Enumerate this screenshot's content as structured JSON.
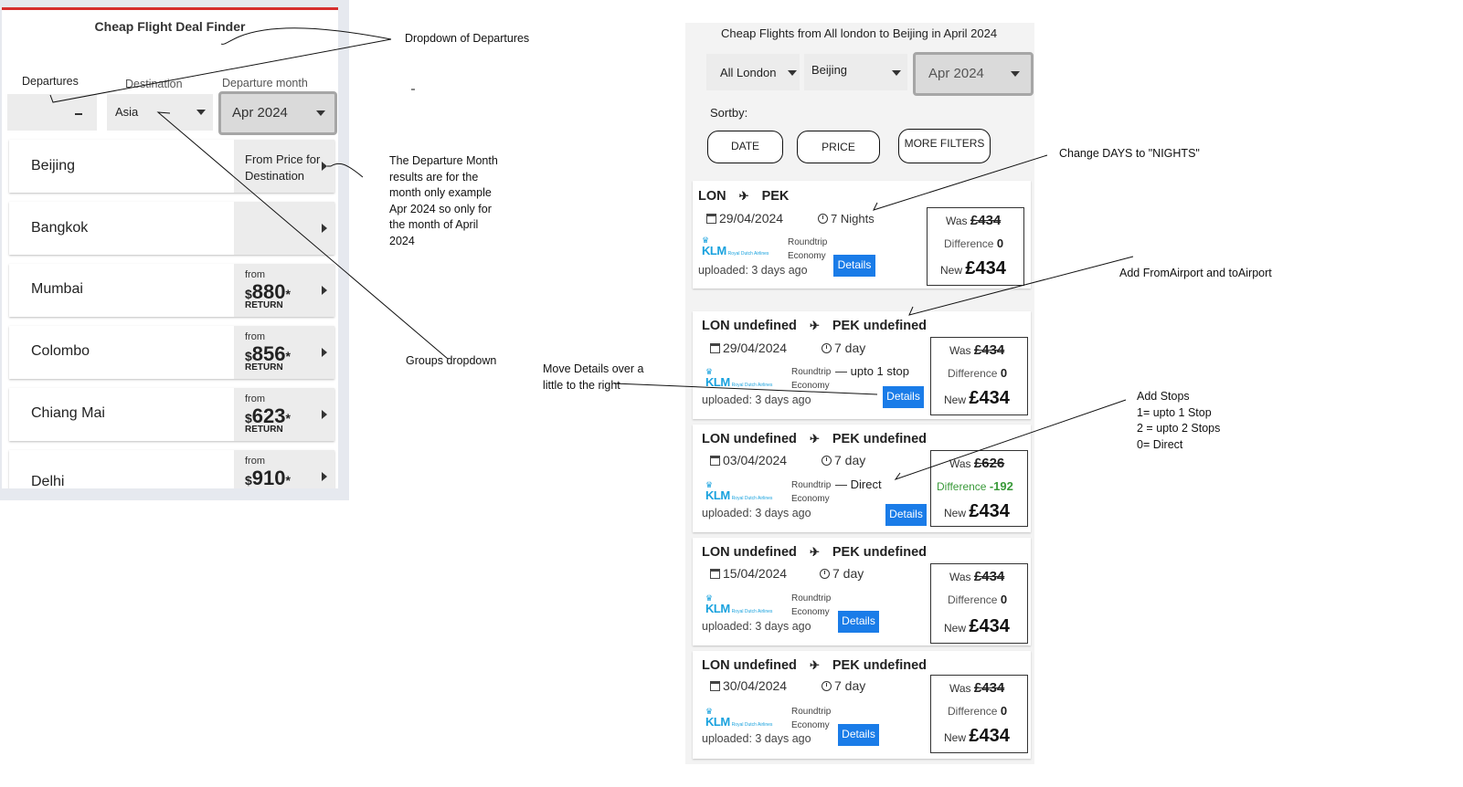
{
  "left": {
    "title": "Cheap Flight Deal Finder",
    "departures_label": "Departures",
    "destination_label": "Destination",
    "destination_value": "Asia",
    "month_label": "Departure month",
    "month_value": "Apr 2024",
    "destinations": [
      {
        "name": "Beijing",
        "price_text": "From Price for Destination"
      },
      {
        "name": "Bangkok"
      },
      {
        "name": "Mumbai",
        "from": "from",
        "currency": "$",
        "price": "880",
        "star": "*",
        "return": "RETURN"
      },
      {
        "name": "Colombo",
        "from": "from",
        "currency": "$",
        "price": "856",
        "star": "*",
        "return": "RETURN"
      },
      {
        "name": "Chiang Mai",
        "from": "from",
        "currency": "$",
        "price": "623",
        "star": "*",
        "return": "RETURN"
      },
      {
        "name": "Delhi",
        "from": "from",
        "currency": "$",
        "price": "910",
        "star": "*"
      }
    ]
  },
  "right": {
    "title": "Cheap Flights from All london to Beijing in April 2024",
    "origin_value": "All London",
    "destination_value": "Beijing",
    "month_value": "Apr 2024",
    "sortby_label": "Sortby:",
    "sort_buttons": [
      "DATE",
      "PRICE",
      "MORE FILTERS"
    ],
    "airline_logo": "KLM",
    "airline_sub": "Royal Dutch Airlines",
    "cards": [
      {
        "from": "LON",
        "to": "PEK",
        "date": "29/04/2024",
        "duration": "7 Nights",
        "trip": "Roundtrip",
        "cabin": "Economy",
        "stops": "",
        "uploaded": "uploaded: 3 days ago",
        "was_label": "Was",
        "was": "£434",
        "diff_label": "Difference",
        "diff": "0",
        "new_label": "New",
        "new": "£434",
        "details": "Details"
      },
      {
        "from": "LON undefined",
        "to": "PEK undefined",
        "date": "29/04/2024",
        "duration": "7 day",
        "trip": "Roundtrip",
        "cabin": "Economy",
        "stops": "upto 1 stop",
        "uploaded": "uploaded: 3 days ago",
        "was_label": "Was",
        "was": "£434",
        "diff_label": "Difference",
        "diff": "0",
        "new_label": "New",
        "new": "£434",
        "details": "Details"
      },
      {
        "from": "LON undefined",
        "to": "PEK undefined",
        "date": "03/04/2024",
        "duration": "7 day",
        "trip": "Roundtrip",
        "cabin": "Economy",
        "stops": "Direct",
        "uploaded": "uploaded: 3 days ago",
        "was_label": "Was",
        "was": "£626",
        "diff_label": "Difference",
        "diff": "-192",
        "new_label": "New",
        "new": "£434",
        "details": "Details"
      },
      {
        "from": "LON undefined",
        "to": "PEK undefined",
        "date": "15/04/2024",
        "duration": "7 day",
        "trip": "Roundtrip",
        "cabin": "Economy",
        "stops": "",
        "uploaded": "uploaded: 3 days ago",
        "was_label": "Was",
        "was": "£434",
        "diff_label": "Difference",
        "diff": "0",
        "new_label": "New",
        "new": "£434",
        "details": "Details"
      },
      {
        "from": "LON undefined",
        "to": "PEK undefined",
        "date": "30/04/2024",
        "duration": "7 day",
        "trip": "Roundtrip",
        "cabin": "Economy",
        "stops": "",
        "uploaded": "uploaded: 3 days ago",
        "was_label": "Was",
        "was": "£434",
        "diff_label": "Difference",
        "diff": "0",
        "new_label": "New",
        "new": "£434",
        "details": "Details"
      }
    ]
  },
  "annotations": {
    "dropdown_departures": "Dropdown of Departures",
    "departure_month_note": [
      "The Departure Month",
      "results are for the",
      "month only example",
      "Apr 2024 so only for",
      "the month of April",
      "2024"
    ],
    "groups_dropdown": "Groups dropdown",
    "move_details": [
      "Move Details over a",
      "little to the right"
    ],
    "change_days": "Change DAYS to \"NIGHTS\"",
    "add_airports": "Add FromAirport and toAirport",
    "add_stops": [
      "Add Stops",
      "1=  upto 1 Stop",
      "2 = upto 2 Stops",
      "0= Direct"
    ]
  },
  "colors": {
    "accent_red": "#d62f2f",
    "details_blue": "#1a7ce8",
    "klm_blue": "#19a2de",
    "diff_green": "#3a9a3a"
  }
}
